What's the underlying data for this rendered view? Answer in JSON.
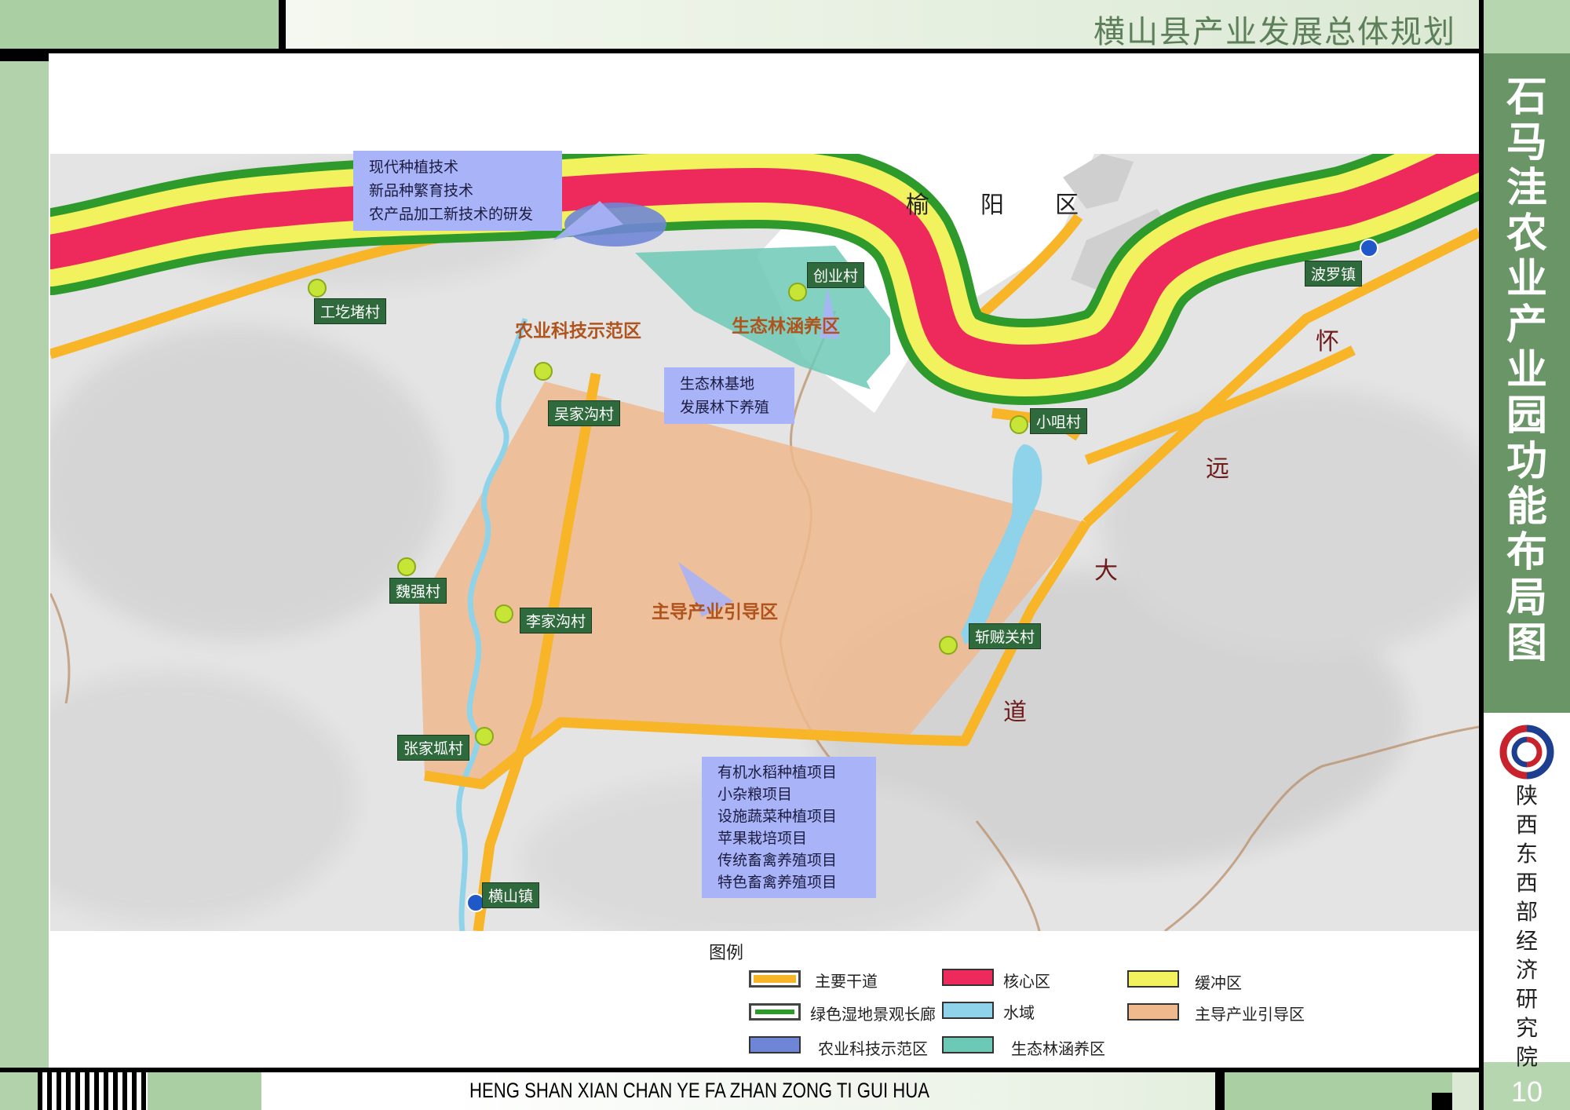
{
  "header": {
    "title": "横山县产业发展总体规划"
  },
  "side": {
    "title": "石马洼农业产业园功能布局图",
    "institute": "陕西东西部经济研究院",
    "page_number": "10"
  },
  "footer": {
    "pinyin": "HENG SHAN XIAN CHAN YE FA ZHAN ZONG TI GUI HUA"
  },
  "map": {
    "region_labels": [
      "榆",
      "阳",
      "区"
    ],
    "road_labels": [
      "怀",
      "远",
      "大",
      "道"
    ],
    "zone_labels": {
      "tech_demo": "农业科技示范区",
      "eco_forest": "生态林涵养区",
      "main_industry": "主导产业引导区"
    },
    "villages": [
      {
        "name": "工圪堵村",
        "type": "village"
      },
      {
        "name": "创业村",
        "type": "village"
      },
      {
        "name": "吴家沟村",
        "type": "village"
      },
      {
        "name": "小咀村",
        "type": "village"
      },
      {
        "name": "魏强村",
        "type": "village"
      },
      {
        "name": "李家沟村",
        "type": "village"
      },
      {
        "name": "斩贼关村",
        "type": "village"
      },
      {
        "name": "张家坬村",
        "type": "village"
      },
      {
        "name": "波罗镇",
        "type": "town"
      },
      {
        "name": "横山镇",
        "type": "town"
      }
    ],
    "callouts": {
      "tech": [
        "现代种植技术",
        "新品种繁育技术",
        "农产品加工新技术的研发"
      ],
      "forest": [
        "生态林基地",
        "发展林下养殖"
      ],
      "industry": [
        "有机水稻种植项目",
        "小杂粮项目",
        "设施蔬菜种植项目",
        "苹果栽培项目",
        "传统畜禽养殖项目",
        "特色畜禽养殖项目"
      ]
    },
    "colors": {
      "road": "#f8b528",
      "core": "#ee2a5c",
      "buffer": "#f2f25e",
      "corridor": "#2f9a2c",
      "water": "#8fd3ea",
      "tech_zone": "#6f86d6",
      "forest_zone": "#6cc9b6",
      "industry_zone": "#efb98d",
      "village_dot": "#c6e536",
      "town_dot": "#2058c8"
    }
  },
  "legend": {
    "title": "图例",
    "items": [
      {
        "label": "主要干道",
        "swatch": "road"
      },
      {
        "label": "核心区",
        "swatch": "core"
      },
      {
        "label": "缓冲区",
        "swatch": "buffer"
      },
      {
        "label": "绿色湿地景观长廊",
        "swatch": "corridor"
      },
      {
        "label": "水域",
        "swatch": "water"
      },
      {
        "label": "主导产业引导区",
        "swatch": "industry_zone"
      },
      {
        "label": "农业科技示范区",
        "swatch": "tech_zone"
      },
      {
        "label": "生态林涵养区",
        "swatch": "forest_zone"
      }
    ]
  }
}
